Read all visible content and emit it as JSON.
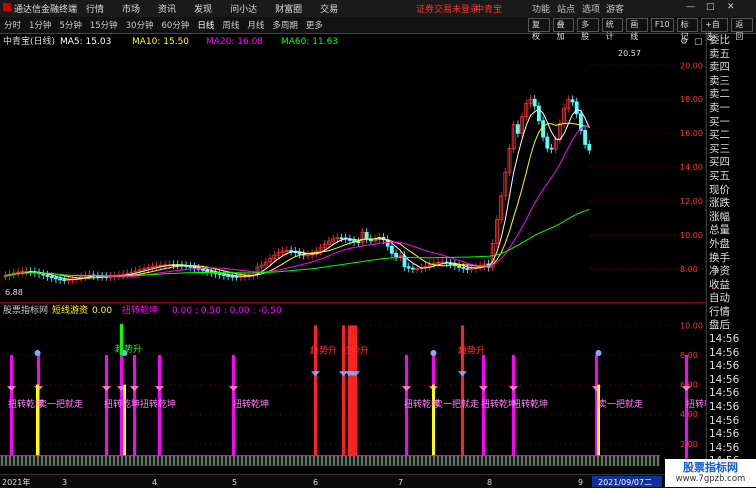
{
  "titlebar": {
    "app_name": "通达信金融终端",
    "menu": [
      "行情",
      "市场",
      "资讯",
      "发现",
      "问小达",
      "财富圈",
      "交易"
    ],
    "login_status": "证券交易未登录",
    "stock_name": "中青宝",
    "right_menu": [
      "功能",
      "站点",
      "选项",
      "游客"
    ]
  },
  "toolbar": {
    "periods": [
      "分时",
      "1分钟",
      "5分钟",
      "15分钟",
      "30分钟",
      "60分钟",
      "日线",
      "周线",
      "月线",
      "多周期",
      "更多"
    ],
    "active_period": "日线",
    "buttons": [
      "复权",
      "叠加",
      "多股",
      "统计",
      "画线",
      "F10",
      "标记",
      "+自选",
      "返回"
    ]
  },
  "main": {
    "title": "中青宝(日线)",
    "ma5": "MA5: 15.03",
    "ma10": "MA10: 15.50",
    "ma20": "MA20: 16.08",
    "ma60": "MA60: 11.63",
    "price_labels": [
      "20.00",
      "18.00",
      "16.00",
      "14.00",
      "12.00",
      "10.00",
      "8.00"
    ],
    "high_mark": "20.57",
    "low_mark": "6.88"
  },
  "indicator": {
    "title": "股票指标网",
    "label": "短线游资",
    "v1": "0.00",
    "name2": "扭转乾坤",
    "values": "0.00 : 0.50 : 0.00 : -0.50",
    "price_labels": [
      "10.00",
      "8.00",
      "6.00",
      "4.00",
      "2.00"
    ],
    "text_sell": "卖一把就走",
    "text_twist": "扭转乾坤",
    "text_trend": "趋势升"
  },
  "right_panel": [
    "委比",
    "卖五",
    "卖四",
    "卖三",
    "卖二",
    "卖一",
    "买一",
    "买二",
    "买三",
    "买四",
    "买五",
    "现价",
    "涨跌",
    "涨幅",
    "总量",
    "外盘",
    "换手",
    "净资",
    "收益",
    "自动",
    "行情",
    "盘后",
    "14:56",
    "14:56",
    "14:56",
    "14:56",
    "14:56",
    "14:56",
    "14:56",
    "14:56",
    "14:56",
    "14:56",
    "14:56"
  ],
  "dates": [
    "2021年",
    "3",
    "4",
    "5",
    "6",
    "7",
    "8",
    "9",
    "2021/09/07二"
  ],
  "watermark": {
    "line1": "股票指标网",
    "line2": "www.7gpzb.com"
  },
  "colors": {
    "ma5": "#ffffff",
    "ma10": "#ffff00",
    "ma20": "#ff00ff",
    "ma60": "#00ff00",
    "up": "#ff3232",
    "down": "#54ffff"
  }
}
